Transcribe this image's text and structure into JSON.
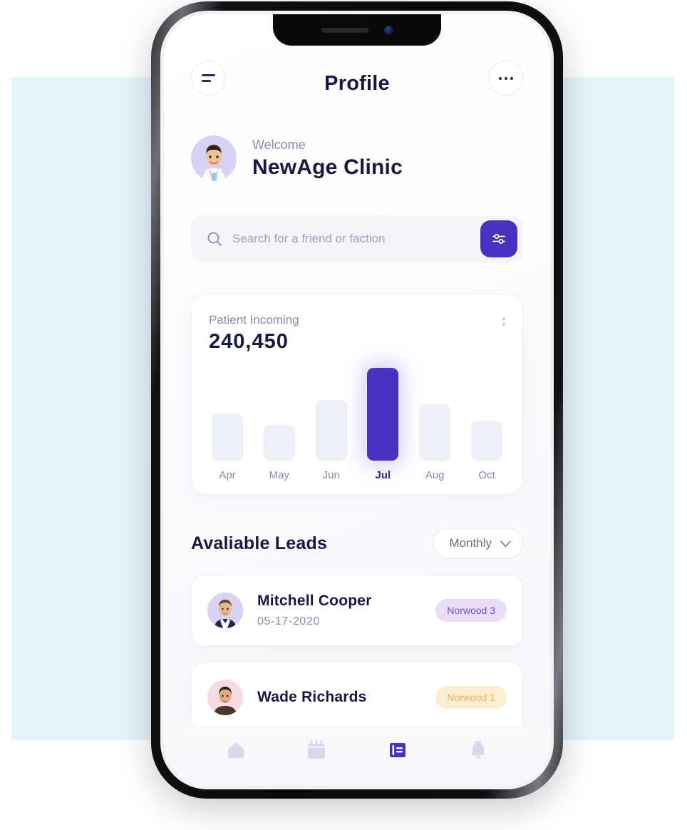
{
  "header": {
    "title": "Profile",
    "menu_icon": "hamburger-icon",
    "more_icon": "more-dots-icon"
  },
  "welcome": {
    "greeting": "Welcome",
    "name": "NewAge Clinic",
    "avatar_icon": "doctor-avatar"
  },
  "search": {
    "placeholder": "Search for a friend or faction",
    "value": "",
    "icon": "search-icon",
    "filter_icon": "sliders-filter-icon",
    "filter_color": "#4a32c0"
  },
  "chart_card": {
    "label": "Patient Incoming",
    "value": "240,450",
    "menu_icon": "vertical-dots-icon"
  },
  "chart_data": {
    "type": "bar",
    "title": "Patient Incoming",
    "categories": [
      "Apr",
      "May",
      "Jun",
      "Jul",
      "Aug",
      "Oct"
    ],
    "values": [
      66,
      50,
      85,
      130,
      79,
      56
    ],
    "highlight_index": 3,
    "highlight_label": "Jul",
    "total_value": "240,450",
    "xlabel": "",
    "ylabel": "",
    "ylim": [
      0,
      132
    ],
    "grid": false,
    "legend": false,
    "bar_color": "#eef0f7",
    "bar_color_active": "#4a32c0"
  },
  "leads": {
    "title": "Avaliable Leads",
    "period": "Monthly",
    "period_chevron_icon": "chevron-down-icon",
    "items": [
      {
        "name": "Mitchell Cooper",
        "date": "05-17-2020",
        "badge": "Norwood 3",
        "badge_style": "purple",
        "badge_bg": "#e9ddfa",
        "badge_fg": "#6f4fd6",
        "avatar_icon": "lead-avatar-male-suit"
      },
      {
        "name": "Wade Richards",
        "date": "",
        "badge": "Norwood 1",
        "badge_style": "amber",
        "badge_bg": "#fdeed2",
        "badge_fg": "#f0b45c",
        "avatar_icon": "lead-avatar-male-casual"
      }
    ]
  },
  "bottom_nav": {
    "items": [
      {
        "icon": "home-icon",
        "active": false
      },
      {
        "icon": "calendar-icon",
        "active": false
      },
      {
        "icon": "notes-book-icon",
        "active": true
      },
      {
        "icon": "bell-icon",
        "active": false
      }
    ],
    "active_color": "#4a32c0",
    "inactive_color": "#d7d8ea"
  },
  "theme": {
    "accent": "#4a32c0",
    "background_band": "#e5f4f8",
    "text_dark": "#19183f",
    "text_muted": "#8b8bb0"
  }
}
